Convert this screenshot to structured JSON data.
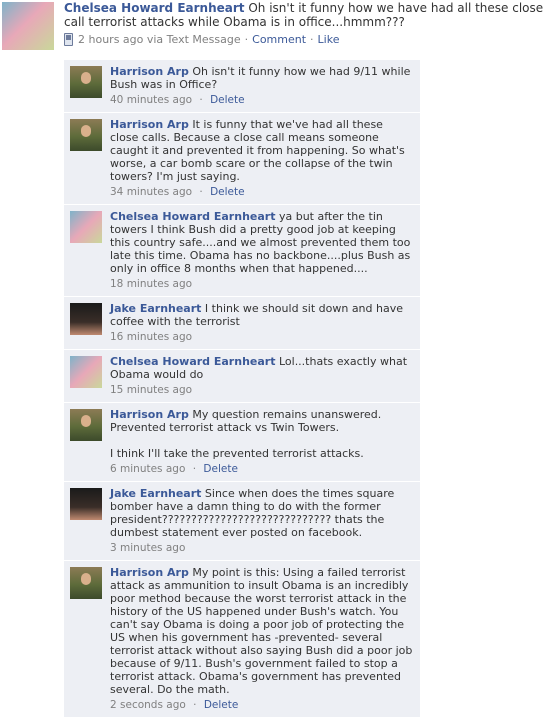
{
  "post": {
    "author": "Chelsea Howard Earnheart",
    "text": "Oh isn't it funny how we have had all these close call terrorist attacks while Obama is in office...hmmm???",
    "time": "2 hours ago via Text Message",
    "comment_link": "Comment",
    "like_link": "Like"
  },
  "comments": [
    {
      "author": "Harrison Arp",
      "text": "Oh isn't it funny how we had 9/11 while Bush was in Office?",
      "time": "40 minutes ago",
      "delete": "Delete"
    },
    {
      "author": "Harrison Arp",
      "text": "It is funny that we've had all these close calls. Because a close call means someone caught it and prevented it from happening. So what's worse, a car bomb scare or the collapse of the twin towers? I'm just saying.",
      "time": "34 minutes ago",
      "delete": "Delete"
    },
    {
      "author": "Chelsea Howard Earnheart",
      "text": "ya but after the tin towers I think Bush did a pretty good job at keeping this country safe....and we almost prevented them too late this time. Obama has no backbone....plus Bush as only in office 8 months when that happened....",
      "time": "18 minutes ago"
    },
    {
      "author": "Jake Earnheart",
      "text": "I think we should sit down and have coffee with the terrorist",
      "time": "16 minutes ago"
    },
    {
      "author": "Chelsea Howard Earnheart",
      "text": "Lol...thats exactly what Obama would do",
      "time": "15 minutes ago"
    },
    {
      "author": "Harrison Arp",
      "text": "My question remains unanswered. Prevented terrorist attack vs Twin Towers.",
      "text2": "I think I'll take the prevented terrorist attacks.",
      "time": "6 minutes ago",
      "delete": "Delete"
    },
    {
      "author": "Jake Earnheart",
      "text": "Since when does the times square bomber have a damn thing to do with the former president????????????????????????????? thats the dumbest statement ever posted on facebook.",
      "time": "3 minutes ago"
    },
    {
      "author": "Harrison Arp",
      "text": "My point is this: Using a failed terrorist attack as ammunition to insult Obama is an incredibly poor method because the worst terrorist attack in the history of the US happened under Bush's watch. You can't say Obama is doing a poor job of protecting the US when his government has -prevented- several terrorist attack without also saying Bush did a poor job because of 9/11. Bush's government failed to stop a terrorist attack. Obama's government has prevented several. Do the math.",
      "time": "2 seconds ago",
      "delete": "Delete"
    }
  ]
}
